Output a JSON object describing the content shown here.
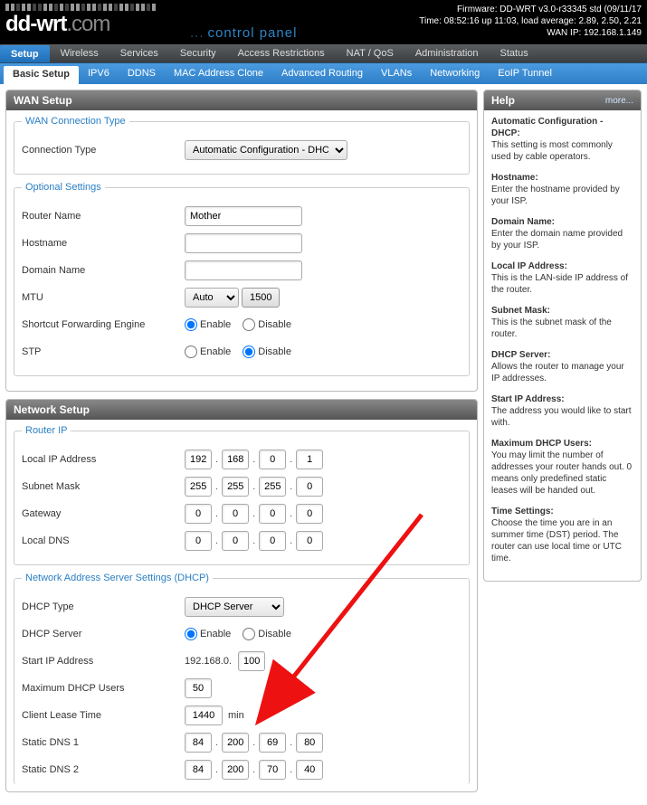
{
  "header": {
    "logo_main": "dd-wrt",
    "logo_ext": ".com",
    "control_panel": "control panel",
    "firmware": "Firmware: DD-WRT v3.0-r33345 std (09/11/17",
    "time": "Time: 08:52:16 up 11:03, load average: 2.89, 2.50, 2.21",
    "wanip": "WAN IP: 192.168.1.149"
  },
  "main_tabs": [
    "Setup",
    "Wireless",
    "Services",
    "Security",
    "Access Restrictions",
    "NAT / QoS",
    "Administration",
    "Status"
  ],
  "main_tab_active": 0,
  "sub_tabs": [
    "Basic Setup",
    "IPV6",
    "DDNS",
    "MAC Address Clone",
    "Advanced Routing",
    "VLANs",
    "Networking",
    "EoIP Tunnel"
  ],
  "sub_tab_active": 0,
  "sections": {
    "wan_setup": "WAN Setup",
    "network_setup": "Network Setup"
  },
  "wan": {
    "legend": "WAN Connection Type",
    "conn_type_label": "Connection Type",
    "conn_type_value": "Automatic Configuration - DHCP"
  },
  "opt": {
    "legend": "Optional Settings",
    "router_name_label": "Router Name",
    "router_name_value": "Mother",
    "hostname_label": "Hostname",
    "hostname_value": "",
    "domain_label": "Domain Name",
    "domain_value": "",
    "mtu_label": "MTU",
    "mtu_mode": "Auto",
    "mtu_value": "1500",
    "sfe_label": "Shortcut Forwarding Engine",
    "stp_label": "STP",
    "enable": "Enable",
    "disable": "Disable"
  },
  "rip": {
    "legend": "Router IP",
    "local_ip_label": "Local IP Address",
    "local_ip": [
      "192",
      "168",
      "0",
      "1"
    ],
    "subnet_label": "Subnet Mask",
    "subnet": [
      "255",
      "255",
      "255",
      "0"
    ],
    "gateway_label": "Gateway",
    "gateway": [
      "0",
      "0",
      "0",
      "0"
    ],
    "localdns_label": "Local DNS",
    "localdns": [
      "0",
      "0",
      "0",
      "0"
    ]
  },
  "dhcp": {
    "legend": "Network Address Server Settings (DHCP)",
    "type_label": "DHCP Type",
    "type_value": "DHCP Server",
    "server_label": "DHCP Server",
    "start_label": "Start IP Address",
    "start_prefix": "192.168.0.",
    "start_value": "100",
    "max_label": "Maximum DHCP Users",
    "max_value": "50",
    "lease_label": "Client Lease Time",
    "lease_value": "1440",
    "lease_unit": "min",
    "dns1_label": "Static DNS 1",
    "dns1": [
      "84",
      "200",
      "69",
      "80"
    ],
    "dns2_label": "Static DNS 2",
    "dns2": [
      "84",
      "200",
      "70",
      "40"
    ]
  },
  "help": {
    "title": "Help",
    "more": "more...",
    "items": [
      {
        "t": "Automatic Configuration - DHCP:",
        "d": "This setting is most commonly used by cable operators."
      },
      {
        "t": "Hostname:",
        "d": "Enter the hostname provided by your ISP."
      },
      {
        "t": "Domain Name:",
        "d": "Enter the domain name provided by your ISP."
      },
      {
        "t": "Local IP Address:",
        "d": "This is the LAN-side IP address of the router."
      },
      {
        "t": "Subnet Mask:",
        "d": "This is the subnet mask of the router."
      },
      {
        "t": "DHCP Server:",
        "d": "Allows the router to manage your IP addresses."
      },
      {
        "t": "Start IP Address:",
        "d": "The address you would like to start with."
      },
      {
        "t": "Maximum DHCP Users:",
        "d": "You may limit the number of addresses your router hands out. 0 means only predefined static leases will be handed out."
      },
      {
        "t": "Time Settings:",
        "d": "Choose the time you are in an summer time (DST) period. The router can use local time or UTC time."
      }
    ]
  }
}
